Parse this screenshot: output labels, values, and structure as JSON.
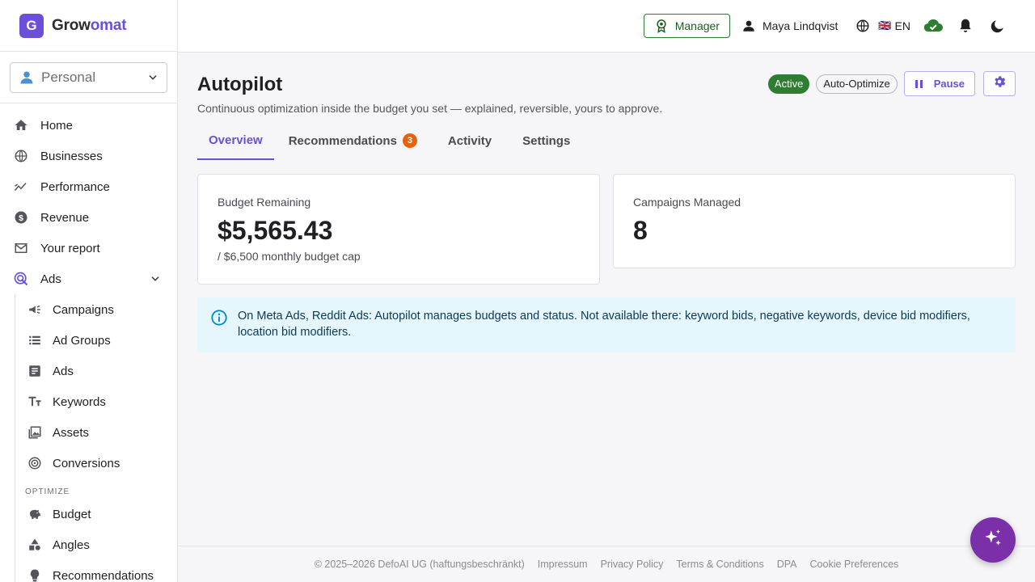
{
  "brand": {
    "logo_letter": "G",
    "name_part1": "Grow",
    "name_part2": "omat",
    "accent": "#6b4fd8"
  },
  "account": {
    "label": "Personal"
  },
  "sidebar": {
    "items": [
      {
        "label": "Home",
        "icon": "home-icon"
      },
      {
        "label": "Businesses",
        "icon": "globe-icon"
      },
      {
        "label": "Performance",
        "icon": "trend-icon"
      },
      {
        "label": "Revenue",
        "icon": "dollar-icon"
      },
      {
        "label": "Your report",
        "icon": "mail-icon"
      },
      {
        "label": "Ads",
        "icon": "ads-icon"
      }
    ],
    "ads_children": [
      {
        "label": "Campaigns",
        "icon": "megaphone-icon"
      },
      {
        "label": "Ad Groups",
        "icon": "list-icon"
      },
      {
        "label": "Ads",
        "icon": "article-icon"
      },
      {
        "label": "Keywords",
        "icon": "text-size-icon"
      },
      {
        "label": "Assets",
        "icon": "image-icon"
      },
      {
        "label": "Conversions",
        "icon": "target-icon"
      }
    ],
    "optimize_section": "OPTIMIZE",
    "optimize_items": [
      {
        "label": "Budget",
        "icon": "piggy-bank-icon"
      },
      {
        "label": "Angles",
        "icon": "shapes-icon"
      },
      {
        "label": "Recommendations",
        "icon": "lightbulb-icon"
      }
    ]
  },
  "header": {
    "manager_label": "Manager",
    "user_name": "Maya Lindqvist",
    "language_flag": "🇬🇧",
    "language": "EN",
    "status_color": "#2e7d32"
  },
  "page": {
    "title": "Autopilot",
    "subtitle": "Continuous optimization inside the budget you set — explained, reversible, yours to approve.",
    "status_badge": "Active",
    "mode_badge": "Auto-Optimize",
    "pause_label": "Pause"
  },
  "tabs": [
    {
      "label": "Overview"
    },
    {
      "label": "Recommendations",
      "count": "3"
    },
    {
      "label": "Activity"
    },
    {
      "label": "Settings"
    }
  ],
  "cards": {
    "budget": {
      "label": "Budget Remaining",
      "value": "$5,565.43",
      "sub": "/ $6,500 monthly budget cap"
    },
    "campaigns": {
      "label": "Campaigns Managed",
      "value": "8"
    }
  },
  "info": {
    "text": "On Meta Ads, Reddit Ads: Autopilot manages budgets and status. Not available there: keyword bids, negative keywords, device bid modifiers, location bid modifiers."
  },
  "footer": {
    "copyright": "© 2025–2026 DefoAI UG (haftungsbeschränkt)",
    "links": [
      "Impressum",
      "Privacy Policy",
      "Terms & Conditions",
      "DPA",
      "Cookie Preferences"
    ]
  }
}
